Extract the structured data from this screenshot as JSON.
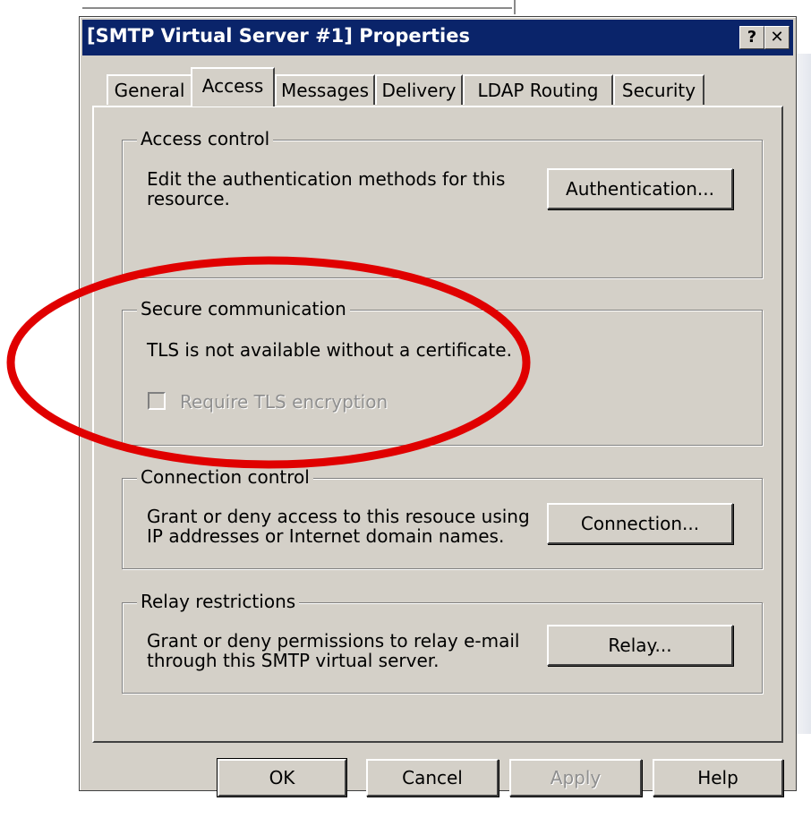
{
  "dialog": {
    "title": "[SMTP Virtual Server #1] Properties",
    "help_label": "?",
    "close_label": "✕"
  },
  "tabs": [
    {
      "label": "General"
    },
    {
      "label": "Access"
    },
    {
      "label": "Messages"
    },
    {
      "label": "Delivery"
    },
    {
      "label": "LDAP Routing"
    },
    {
      "label": "Security"
    }
  ],
  "active_tab": "Access",
  "access_control": {
    "title": "Access control",
    "line1": "Edit the authentication methods for this",
    "line2": "resource.",
    "button": "Authentication..."
  },
  "secure_communication": {
    "title": "Secure communication",
    "status": "TLS is not available without a certificate.",
    "checkbox_label": "Require TLS encryption",
    "checkbox_checked": false,
    "checkbox_disabled": true
  },
  "connection_control": {
    "title": "Connection control",
    "line1": "Grant or deny access to this resouce using",
    "line2": "IP addresses or Internet domain names.",
    "button": "Connection..."
  },
  "relay_restrictions": {
    "title": "Relay restrictions",
    "line1": "Grant or deny permissions to relay e-mail",
    "line2": "through this SMTP virtual server.",
    "button": "Relay..."
  },
  "footer": {
    "ok": "OK",
    "cancel": "Cancel",
    "apply": "Apply",
    "help": "Help"
  },
  "colors": {
    "titlebar": "#0a246a",
    "dialog_face": "#d4d0c8",
    "highlight_circle": "#e00000"
  }
}
